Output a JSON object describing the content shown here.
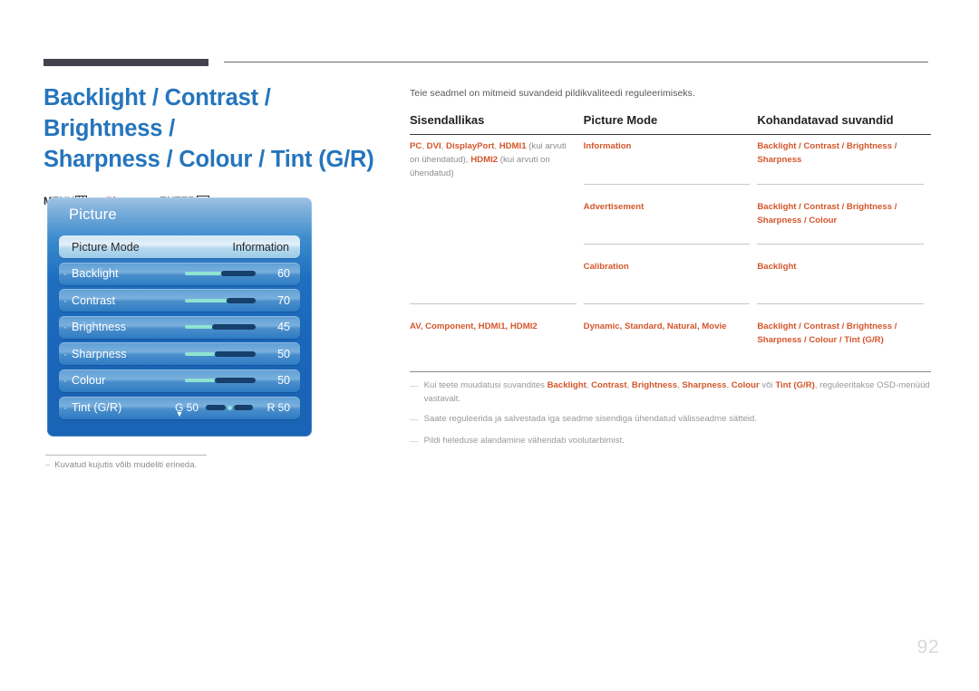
{
  "header": {
    "title": "Backlight / Contrast / Brightness / Sharpness / Colour / Tint (G/R)",
    "title_line1": "Backlight / Contrast / Brightness /",
    "title_line2": "Sharpness / Colour / Tint (G/R)",
    "menu_path": {
      "menu_label": "MENU",
      "menu_icon": "menu-grid-icon",
      "arrow1": "→",
      "picture_label": "Picture",
      "arrow2": "→",
      "enter_label": "ENTER",
      "enter_icon": "enter-key-icon"
    }
  },
  "osd": {
    "title": "Picture",
    "scroll_arrow": "▼",
    "bullet": "·",
    "rows": [
      {
        "label": "Picture Mode",
        "value": "Information",
        "type": "option",
        "selected": true
      },
      {
        "label": "Backlight",
        "value": "60",
        "type": "slider",
        "percent": 60,
        "selected": false
      },
      {
        "label": "Contrast",
        "value": "70",
        "type": "slider",
        "percent": 70,
        "selected": false
      },
      {
        "label": "Brightness",
        "value": "45",
        "type": "slider",
        "percent": 45,
        "selected": false
      },
      {
        "label": "Sharpness",
        "value": "50",
        "type": "slider",
        "percent": 50,
        "selected": false
      },
      {
        "label": "Colour",
        "value": "50",
        "type": "slider",
        "percent": 50,
        "selected": false
      },
      {
        "label": "Tint (G/R)",
        "type": "tint",
        "left_value": "G 50",
        "right_value": "R 50",
        "selected": false
      }
    ]
  },
  "left_note": {
    "dash": "–",
    "text": "Kuvatud kujutis võib mudeliti erineda."
  },
  "right": {
    "intro": "Teie seadmel on mitmeid suvandeid pildikvaliteedi reguleerimiseks.",
    "table": {
      "headers": [
        "Sisendallikas",
        "Picture Mode",
        "Kohandatavad suvandid"
      ],
      "rows": [
        {
          "source_bold_1": "PC",
          "source_sep_1": ", ",
          "source_bold_2": "DVI",
          "source_sep_2": ", ",
          "source_bold_3": "DisplayPort",
          "source_sep_3": ", ",
          "source_bold_4": "HDMI1",
          "source_gray_1": " (kui arvuti on ühendatud), ",
          "source_bold_5": "HDMI2",
          "source_gray_2": " (kui arvuti on ühendatud)",
          "modes": [
            {
              "mode": "Information",
              "options_line1": "Backlight / Contrast / Brightness /",
              "options_line2": "Sharpness"
            },
            {
              "mode": "Advertisement",
              "options_line1": "Backlight / Contrast / Brightness /",
              "options_line2": "Sharpness / Colour"
            },
            {
              "mode": "Calibration",
              "options_line1": "Backlight",
              "options_line2": ""
            }
          ]
        },
        {
          "source_plain": "AV, Component, HDMI1, HDMI2",
          "modes": [
            {
              "mode": "Dynamic, Standard, Natural, Movie",
              "options_line1": "Backlight / Contrast / Brightness /",
              "options_line2": "Sharpness / Colour / Tint (G/R)"
            }
          ]
        }
      ]
    },
    "notes": [
      {
        "dash": "—",
        "part1": "Kui teete muudatusi suvandites ",
        "b1": "Backlight",
        "s1": ", ",
        "b2": "Contrast",
        "s2": ", ",
        "b3": "Brightness",
        "s3": ", ",
        "b4": "Sharpness",
        "s4": ", ",
        "b5": "Colour",
        "s5": " või ",
        "b6": "Tint (G/R)",
        "part2": ", reguleeritakse OSD-menüüd vastavalt."
      },
      {
        "dash": "—",
        "part1": "Saate reguleerida ja salvestada iga seadme sisendiga ühendatud välisseadme sätteid."
      },
      {
        "dash": "—",
        "part1": "Pildi heleduse alandamine vähendab voolutarbimist."
      }
    ]
  },
  "page_number": "92"
}
